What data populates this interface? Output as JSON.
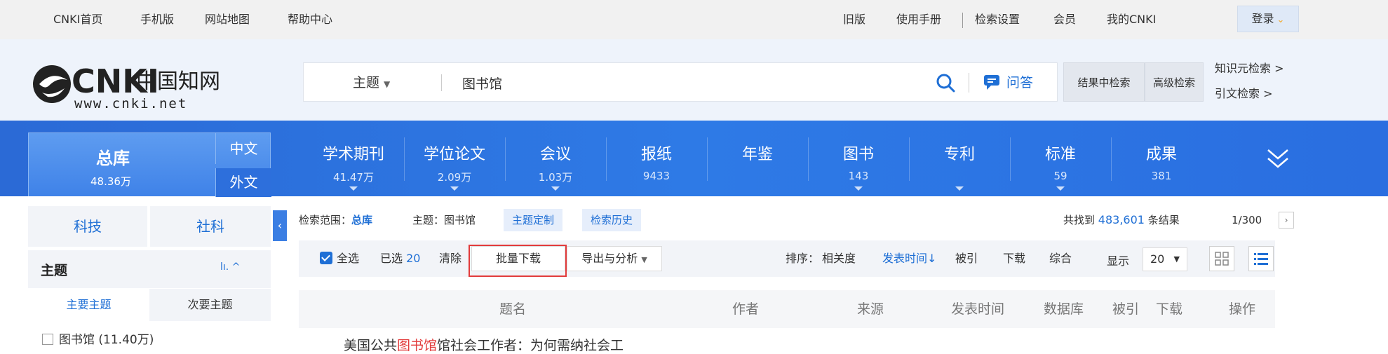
{
  "topbar": {
    "left_links": [
      "CNKI首页",
      "手机版",
      "网站地图",
      "帮助中心"
    ],
    "right_links": [
      "旧版",
      "使用手册",
      "检索设置",
      "会员",
      "我的CNKI"
    ],
    "login_label": "登录"
  },
  "logo": {
    "main": "CNKI",
    "cn_text": "中国知网",
    "url_text": "www.cnki.net"
  },
  "search": {
    "field_label": "主题",
    "query": "图书馆",
    "qa_label": "问答",
    "search_in_results": "结果中检索",
    "advanced": "高级检索",
    "knowledge_search": "知识元检索 >",
    "citation_search": "引文检索 >"
  },
  "nav": {
    "total_label": "总库",
    "total_count": "48.36万",
    "lang_zh": "中文",
    "lang_en": "外文",
    "items": [
      {
        "label": "学术期刊",
        "count": "41.47万"
      },
      {
        "label": "学位论文",
        "count": "2.09万"
      },
      {
        "label": "会议",
        "count": "1.03万"
      },
      {
        "label": "报纸",
        "count": "9433"
      },
      {
        "label": "年鉴",
        "count": ""
      },
      {
        "label": "图书",
        "count": "143"
      },
      {
        "label": "专利",
        "count": ""
      },
      {
        "label": "标准",
        "count": "59"
      },
      {
        "label": "成果",
        "count": "381"
      }
    ]
  },
  "left_panel": {
    "tab_tech": "科技",
    "tab_social": "社科",
    "section_title": "主题",
    "section_icons": "lı. ^",
    "subtab_main": "主要主题",
    "subtab_secondary": "次要主题",
    "facet_first": "图书馆 (11.40万)"
  },
  "results": {
    "scope_prefix": "检索范围：",
    "scope_value": "总库",
    "scope_topic": "主题：图书馆",
    "chip_custom": "主题定制",
    "chip_history": "检索历史",
    "found_prefix": "共找到",
    "found_count": "483,601",
    "found_suffix": "条结果",
    "page_info": "1/300",
    "toolbar": {
      "select_all": "全选",
      "selected_prefix": "已选",
      "selected_count": "20",
      "clear": "清除",
      "batch_download": "批量下载",
      "export": "导出与分析",
      "sort_prefix": "排序：",
      "sort_relevance": "相关度",
      "sort_date": "发表时间",
      "sort_cited": "被引",
      "sort_download": "下载",
      "sort_combined": "综合",
      "display_label": "显示",
      "display_count": "20"
    },
    "columns": [
      "题名",
      "作者",
      "来源",
      "发表时间",
      "数据库",
      "被引",
      "下载",
      "操作"
    ],
    "first_row_prefix": "美国公共",
    "first_row_highlight": "图书馆",
    "first_row_suffix": "馆社会工作者：为何需纳社会工"
  }
}
